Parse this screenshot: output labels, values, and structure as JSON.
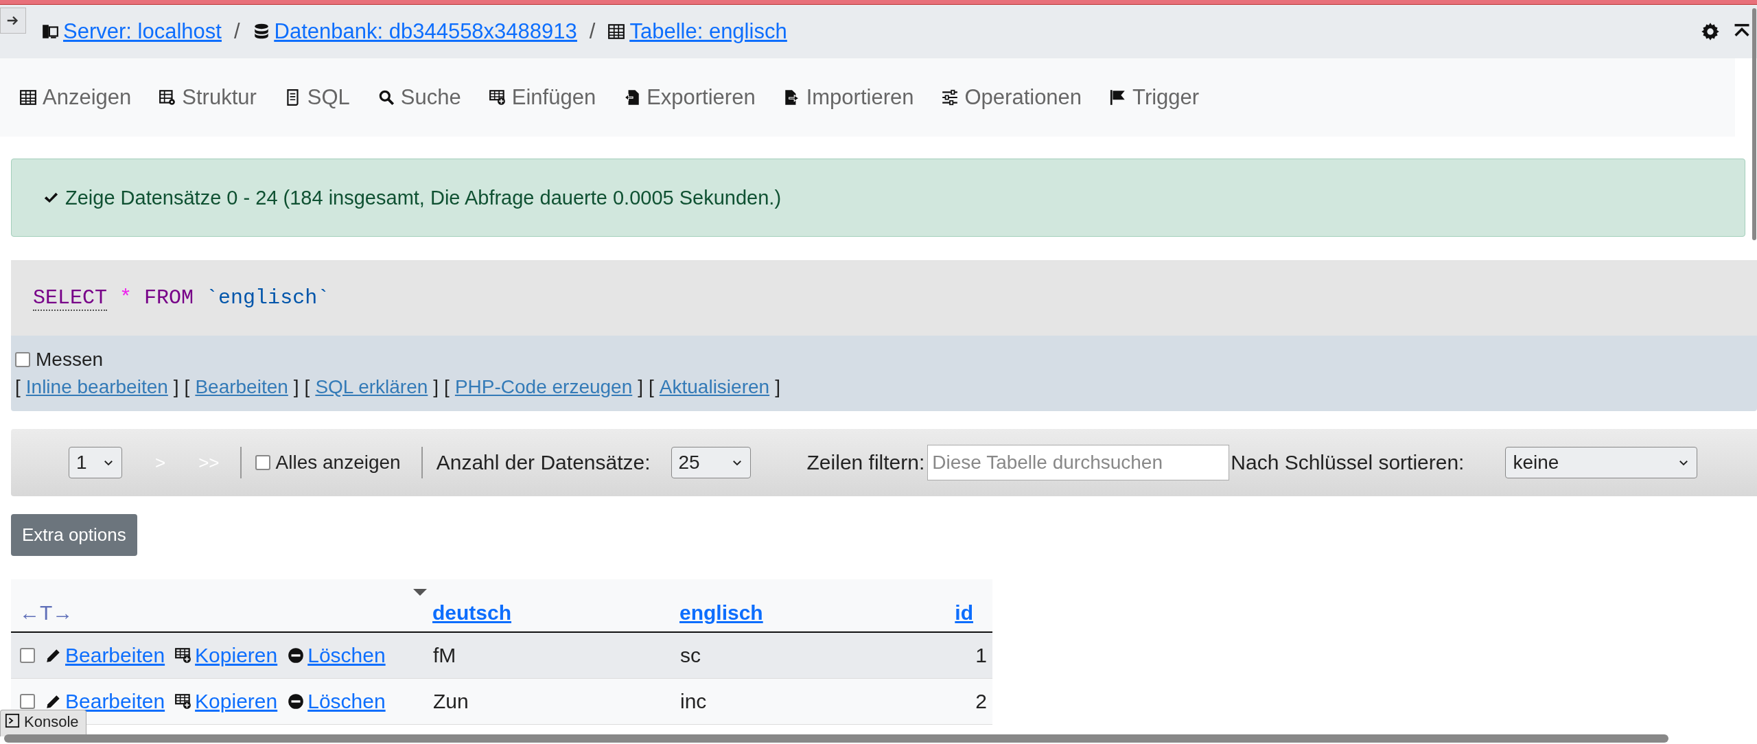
{
  "breadcrumb": [
    {
      "kind": "server",
      "label": "Server: localhost"
    },
    {
      "kind": "database",
      "label": "Datenbank: db344558x3488913"
    },
    {
      "kind": "table",
      "label": "Tabelle: englisch"
    }
  ],
  "breadcrumb_separator": "/",
  "tabs": [
    {
      "kind": "browse",
      "label": "Anzeigen",
      "selected": false
    },
    {
      "kind": "structure",
      "label": "Struktur",
      "selected": false
    },
    {
      "kind": "sql",
      "label": "SQL",
      "selected": false
    },
    {
      "kind": "search",
      "label": "Suche",
      "selected": false
    },
    {
      "kind": "insert",
      "label": "Einfügen",
      "selected": false
    },
    {
      "kind": "export",
      "label": "Exportieren",
      "selected": false
    },
    {
      "kind": "import",
      "label": "Importieren",
      "selected": false
    },
    {
      "kind": "operations",
      "label": "Operationen",
      "selected": false
    },
    {
      "kind": "trigger",
      "label": "Trigger",
      "selected": false
    }
  ],
  "success_message": "Zeige Datensätze 0 - 24 (184 insgesamt, Die Abfrage dauerte 0.0005 Sekunden.)",
  "sql_query": [
    {
      "kind": "keyword",
      "text": "SELECT"
    },
    {
      "kind": "operator",
      "text": "*"
    },
    {
      "kind": "keyword",
      "text": "FROM"
    },
    {
      "kind": "identifier",
      "text": "`englisch`"
    }
  ],
  "profiling": {
    "label": "Messen",
    "checked": false
  },
  "link_brackets": [
    "[",
    "]"
  ],
  "query_links": [
    "Inline bearbeiten",
    "Bearbeiten",
    "SQL erklären",
    "PHP-Code erzeugen",
    "Aktualisieren"
  ],
  "navigation": {
    "page": "1",
    "next": ">",
    "last": ">>",
    "show_all": {
      "label": "Alles anzeigen",
      "checked": false
    },
    "rows_label": "Anzahl der Datensätze:",
    "rows_value": "25",
    "filter_label": "Zeilen filtern:",
    "filter_placeholder": "Diese Tabelle durchsuchen",
    "sort_label": "Nach Schlüssel sortieren:",
    "sort_value": "keine"
  },
  "extra_options_button": "Extra options",
  "table": {
    "column_toggle": "←T→",
    "columns": [
      {
        "label": "deutsch",
        "sorted": true
      },
      {
        "label": "englisch",
        "sorted": false
      },
      {
        "label": "id",
        "sorted": false
      }
    ],
    "rows": [
      {
        "checked": false,
        "highlighted": true,
        "actions": [
          "Bearbeiten",
          "Kopieren",
          "Löschen"
        ],
        "cells": [
          "fM",
          "sc",
          "1"
        ]
      },
      {
        "checked": false,
        "highlighted": false,
        "actions": [
          "Bearbeiten",
          "Kopieren",
          "Löschen"
        ],
        "cells": [
          "Zun",
          "inc",
          "2"
        ]
      }
    ]
  },
  "console_tab": "Konsole"
}
